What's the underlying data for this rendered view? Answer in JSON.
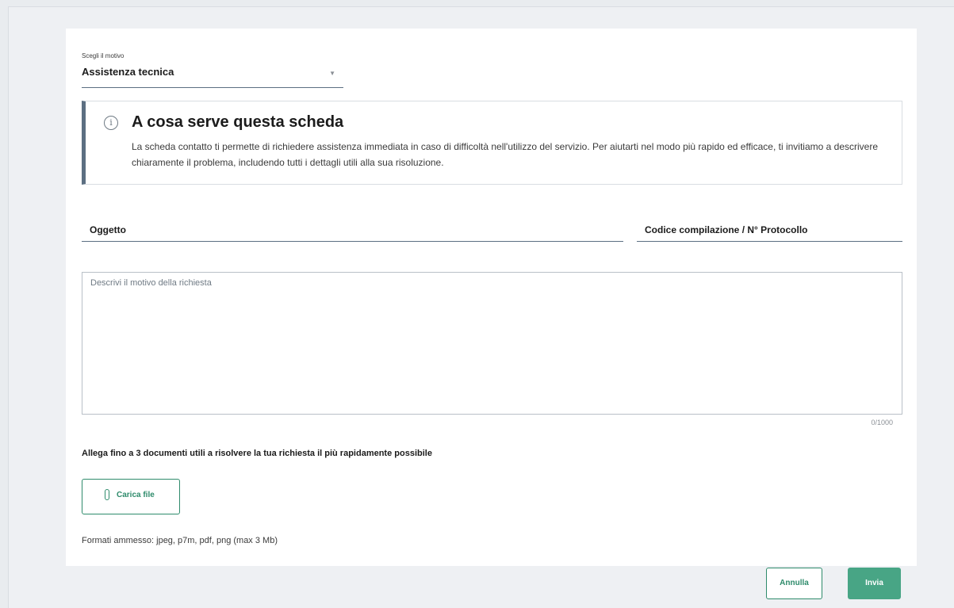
{
  "form": {
    "reason_select": {
      "label": "Scegli il motivo",
      "value": "Assistenza tecnica",
      "caret_icon": "chevron-down-icon"
    },
    "info_box": {
      "icon": "info-icon",
      "icon_glyph": "i",
      "title": "A cosa serve questa scheda",
      "text": "La scheda contatto ti permette di richiedere assistenza immediata in caso di difficoltà nell'utilizzo del servizio. Per aiutarti nel modo più rapido ed efficace, ti invitiamo a descrivere chiaramente il problema, includendo tutti i dettagli utili alla sua risoluzione."
    },
    "subject_field": {
      "label": "Oggetto"
    },
    "protocol_field": {
      "label": "Codice compilazione / N° Protocollo"
    },
    "description": {
      "placeholder": "Descrivi il motivo della richiesta",
      "counter": "0/1000"
    },
    "attachments": {
      "title": "Allega fino a 3 documenti utili a risolvere la tua richiesta il più rapidamente possibile",
      "upload_label": "Carica file",
      "upload_icon": "paperclip-icon",
      "formats": "Formati ammesso: jpeg, p7m, pdf, png (max 3 Mb)"
    }
  },
  "actions": {
    "cancel_label": "Annulla",
    "send_label": "Invia"
  },
  "colors": {
    "accent": "#2e8b6b",
    "send_button": "#48a585",
    "background": "#e9ecef",
    "border": "#5c6f82"
  }
}
